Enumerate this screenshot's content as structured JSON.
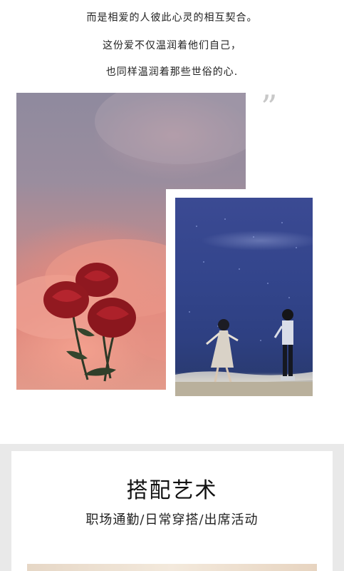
{
  "poem": {
    "line1": "而是相爱的人彼此心灵的相互契合。",
    "line2": "这份爱不仅温润着他们自己，",
    "line3": "也同样温润着那些世俗的心."
  },
  "quote_mark": "”",
  "images": {
    "left_photo": "rose-clouds-photo",
    "right_photo": "couple-by-sea-photo"
  },
  "section": {
    "title": "搭配艺术",
    "subtitle": "职场通勤/日常穿搭/出席活动"
  },
  "colors": {
    "band": "#e9e9e9",
    "quote": "#c8c8c8",
    "sea": "#33458c",
    "rose": "#9e1b22"
  }
}
